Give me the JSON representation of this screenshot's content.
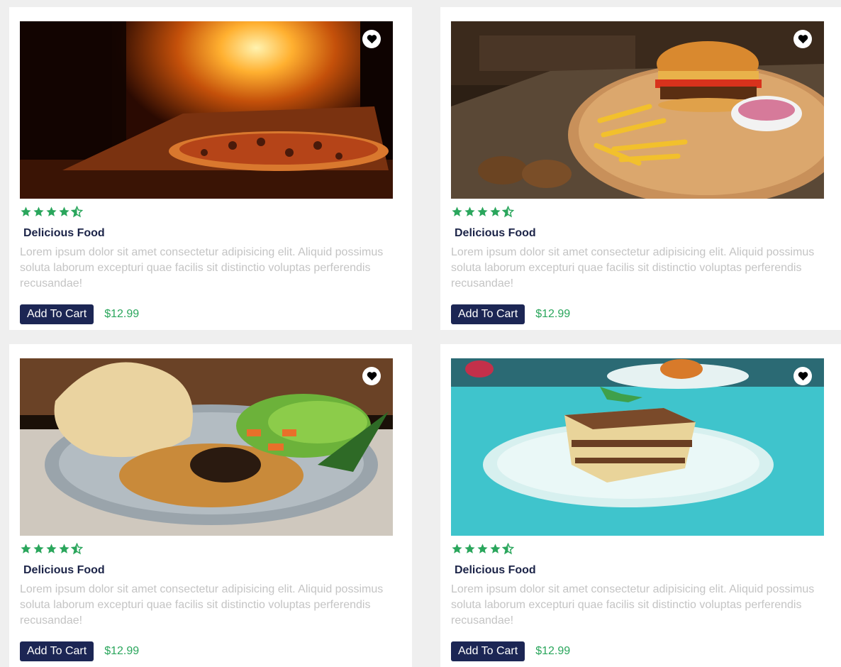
{
  "colors": {
    "accent": "#2aa65c",
    "button": "#1c2654",
    "title": "#1c2448",
    "text_muted": "#c4c4c4",
    "background": "#efefef"
  },
  "products": [
    {
      "image": "pizza-oven-photo",
      "rating": 4.5,
      "title": "Delicious Food",
      "description": "Lorem ipsum dolor sit amet consectetur adipisicing elit. Aliquid possimus soluta laborum excepturi quae facilis sit distinctio voluptas perferendis recusandae!",
      "button_label": "Add To Cart",
      "price": "$12.99"
    },
    {
      "image": "burger-fries-photo",
      "rating": 4.5,
      "title": "Delicious Food",
      "description": "Lorem ipsum dolor sit amet consectetur adipisicing elit. Aliquid possimus soluta laborum excepturi quae facilis sit distinctio voluptas perferendis recusandae!",
      "button_label": "Add To Cart",
      "price": "$12.99"
    },
    {
      "image": "nasi-goreng-photo",
      "rating": 4.5,
      "title": "Delicious Food",
      "description": "Lorem ipsum dolor sit amet consectetur adipisicing elit. Aliquid possimus soluta laborum excepturi quae facilis sit distinctio voluptas perferendis recusandae!",
      "button_label": "Add To Cart",
      "price": "$12.99"
    },
    {
      "image": "tiramisu-photo",
      "rating": 4.5,
      "title": "Delicious Food",
      "description": "Lorem ipsum dolor sit amet consectetur adipisicing elit. Aliquid possimus soluta laborum excepturi quae facilis sit distinctio voluptas perferendis recusandae!",
      "button_label": "Add To Cart",
      "price": "$12.99"
    }
  ]
}
